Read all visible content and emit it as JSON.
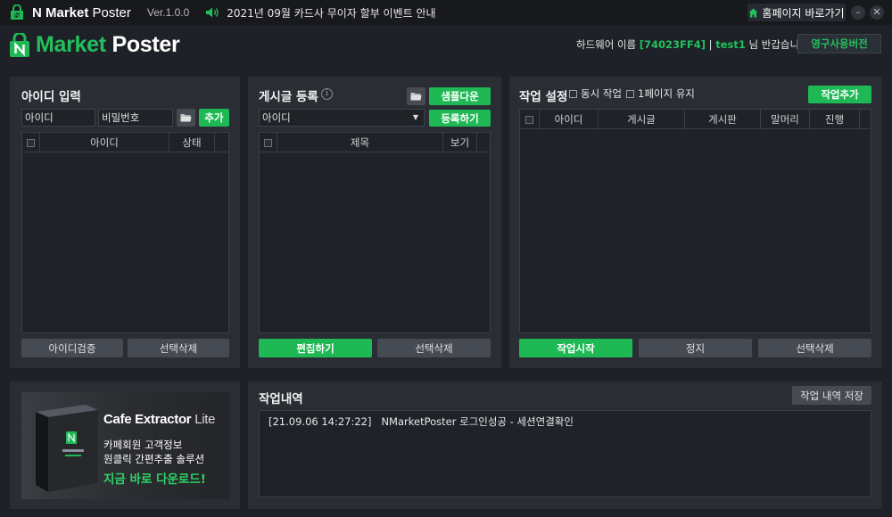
{
  "titlebar": {
    "app_name_bold": "N Market",
    "app_name_light": "Poster",
    "version": "Ver.1.0.0",
    "notice": "2021년 09월 카드사 무이자 할부 이벤트 안내",
    "home_button": "홈페이지 바로가기",
    "minimize": "–",
    "close": "✕"
  },
  "header": {
    "logo_green": "Market",
    "logo_white": "Poster",
    "greeting_prefix": "하드웨어 이름 ",
    "hwid": "[74023FF4]",
    "separator": " | ",
    "username": "test1",
    "greeting_suffix": " 님 반갑습니다!",
    "permanent_button": "영구사용버전"
  },
  "id_panel": {
    "title": "아이디 입력",
    "id_input": "아이디",
    "pw_input": "비밀번호",
    "add_button": "추가",
    "columns": [
      "아이디",
      "상태"
    ],
    "verify_button": "아이디검증",
    "delete_button": "선택삭제"
  },
  "post_panel": {
    "title": "게시글 등록",
    "sample_button": "샘플다운",
    "id_select": "아이디",
    "register_button": "등록하기",
    "columns": [
      "제목",
      "보기"
    ],
    "edit_button": "편집하기",
    "delete_button": "선택삭제"
  },
  "task_panel": {
    "title": "작업 설정",
    "opt_concurrent": "동시 작업",
    "opt_keep_page": "1페이지 유지",
    "add_button": "작업추가",
    "columns": [
      "아이디",
      "게시글",
      "게시판",
      "말머리",
      "진행"
    ],
    "start_button": "작업시작",
    "stop_button": "정지",
    "delete_button": "선택삭제"
  },
  "log_panel": {
    "title": "작업내역",
    "save_button": "작업 내역 저장",
    "entries": [
      "[21.09.06 14:27:22]   NMarketPoster 로그인성공 - 세션연결확인"
    ]
  },
  "ad": {
    "title_bold": "Cafe Extractor",
    "title_light": "Lite",
    "line1": "카페회원 고객정보",
    "line2": "원클릭 간편추출 솔루션",
    "cta": "지금 바로 다운로드!"
  },
  "colors": {
    "accent": "#1eb954",
    "background": "#1e2127",
    "panel": "#2a2d34"
  },
  "icons": [
    "lock-icon",
    "speaker-icon",
    "home-icon",
    "folder-icon",
    "info-icon",
    "dropdown-arrow-icon"
  ]
}
